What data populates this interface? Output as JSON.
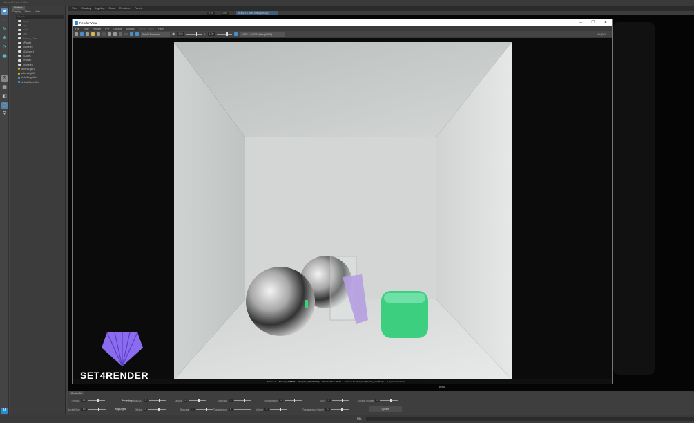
{
  "app": {
    "top_title": "Mirrord Graph Editor"
  },
  "outliner": {
    "tab": "Outliner",
    "menu": [
      "Display",
      "Show",
      "Help"
    ],
    "search_placeholder": "Search...",
    "items": [
      {
        "label": "persp",
        "type": "camera",
        "dim": true
      },
      {
        "label": "top",
        "type": "camera",
        "dim": true
      },
      {
        "label": "front",
        "type": "camera",
        "dim": true
      },
      {
        "label": "side",
        "type": "camera",
        "dim": true
      },
      {
        "label": "Render_Cam",
        "type": "camera",
        "dim": true
      },
      {
        "label": "pPlane1",
        "type": "mesh"
      },
      {
        "label": "pSphere2",
        "type": "mesh"
      },
      {
        "label": "pCylinder1",
        "type": "mesh"
      },
      {
        "label": "pCube1",
        "type": "mesh"
      },
      {
        "label": "pPlane2",
        "type": "mesh"
      },
      {
        "label": "pSphere3",
        "type": "mesh"
      },
      {
        "label": "aiAreaLight1",
        "type": "light"
      },
      {
        "label": "aiAreaLight2",
        "type": "light"
      },
      {
        "label": "defaultLightSet",
        "type": "set"
      },
      {
        "label": "defaultObjectSet",
        "type": "set"
      }
    ]
  },
  "viewport": {
    "menu": [
      "View",
      "Shading",
      "Lighting",
      "Show",
      "Renderer",
      "Panels"
    ],
    "exposure": "0.00",
    "gamma": "1.00",
    "colorspace": "ACES 1.0 SDR-video (sRGB)",
    "camera_label": "persp"
  },
  "render_view": {
    "title": "Render View",
    "menu": [
      "File",
      "View",
      "Render",
      "IPR",
      "Options",
      "Display",
      "Render Target",
      "Help"
    ],
    "ratio": "1:1",
    "renderer": "Arnold Renderer",
    "exposure": "0.00",
    "gamma": "1.00",
    "colorspace": "ACES 1.0 SDR-video (sRGB)",
    "zoom": "0% (0x0)",
    "status": [
      "Frame: 1",
      "Memory: 3958Mb",
      "Sampling: [3/4/4/4/4/4]",
      "Render Time: 19:13",
      "Camera: Render_Cam|Render_CamShape",
      "Layer: masterLayer"
    ],
    "logo_text": "SET4RENDER",
    "colors": {
      "sphere": "#c0c0c0",
      "cube": "#3ccf80",
      "plane": "#b59ee0",
      "logo": "#8b6cf0"
    }
  },
  "render_settings": {
    "tab": "RenderSet",
    "row1": [
      {
        "label": "Threads",
        "value": "24"
      },
      {
        "label": "Sampling",
        "value": "",
        "heading": true
      },
      {
        "label": "Camera (AA)",
        "value": "3"
      },
      {
        "label": "Diffuse",
        "value": "4"
      },
      {
        "label": "Specular",
        "value": "4"
      },
      {
        "label": "Transmission",
        "value": "4"
      },
      {
        "label": "SSS",
        "value": "4"
      },
      {
        "label": "Volume Indirect",
        "value": "0"
      }
    ],
    "row2": [
      {
        "label": "Bucket Size",
        "value": "64"
      },
      {
        "label": "Ray Depth",
        "value": "",
        "heading": true
      },
      {
        "label": "Diffuse",
        "value": "3"
      },
      {
        "label": "Specular",
        "value": "3"
      },
      {
        "label": "Transmission",
        "value": "6"
      },
      {
        "label": "Volume",
        "value": "0"
      },
      {
        "label": "Transparency Depth",
        "value": "10"
      }
    ],
    "update_label": "Update"
  },
  "command": {
    "mel_label": "MEL"
  }
}
